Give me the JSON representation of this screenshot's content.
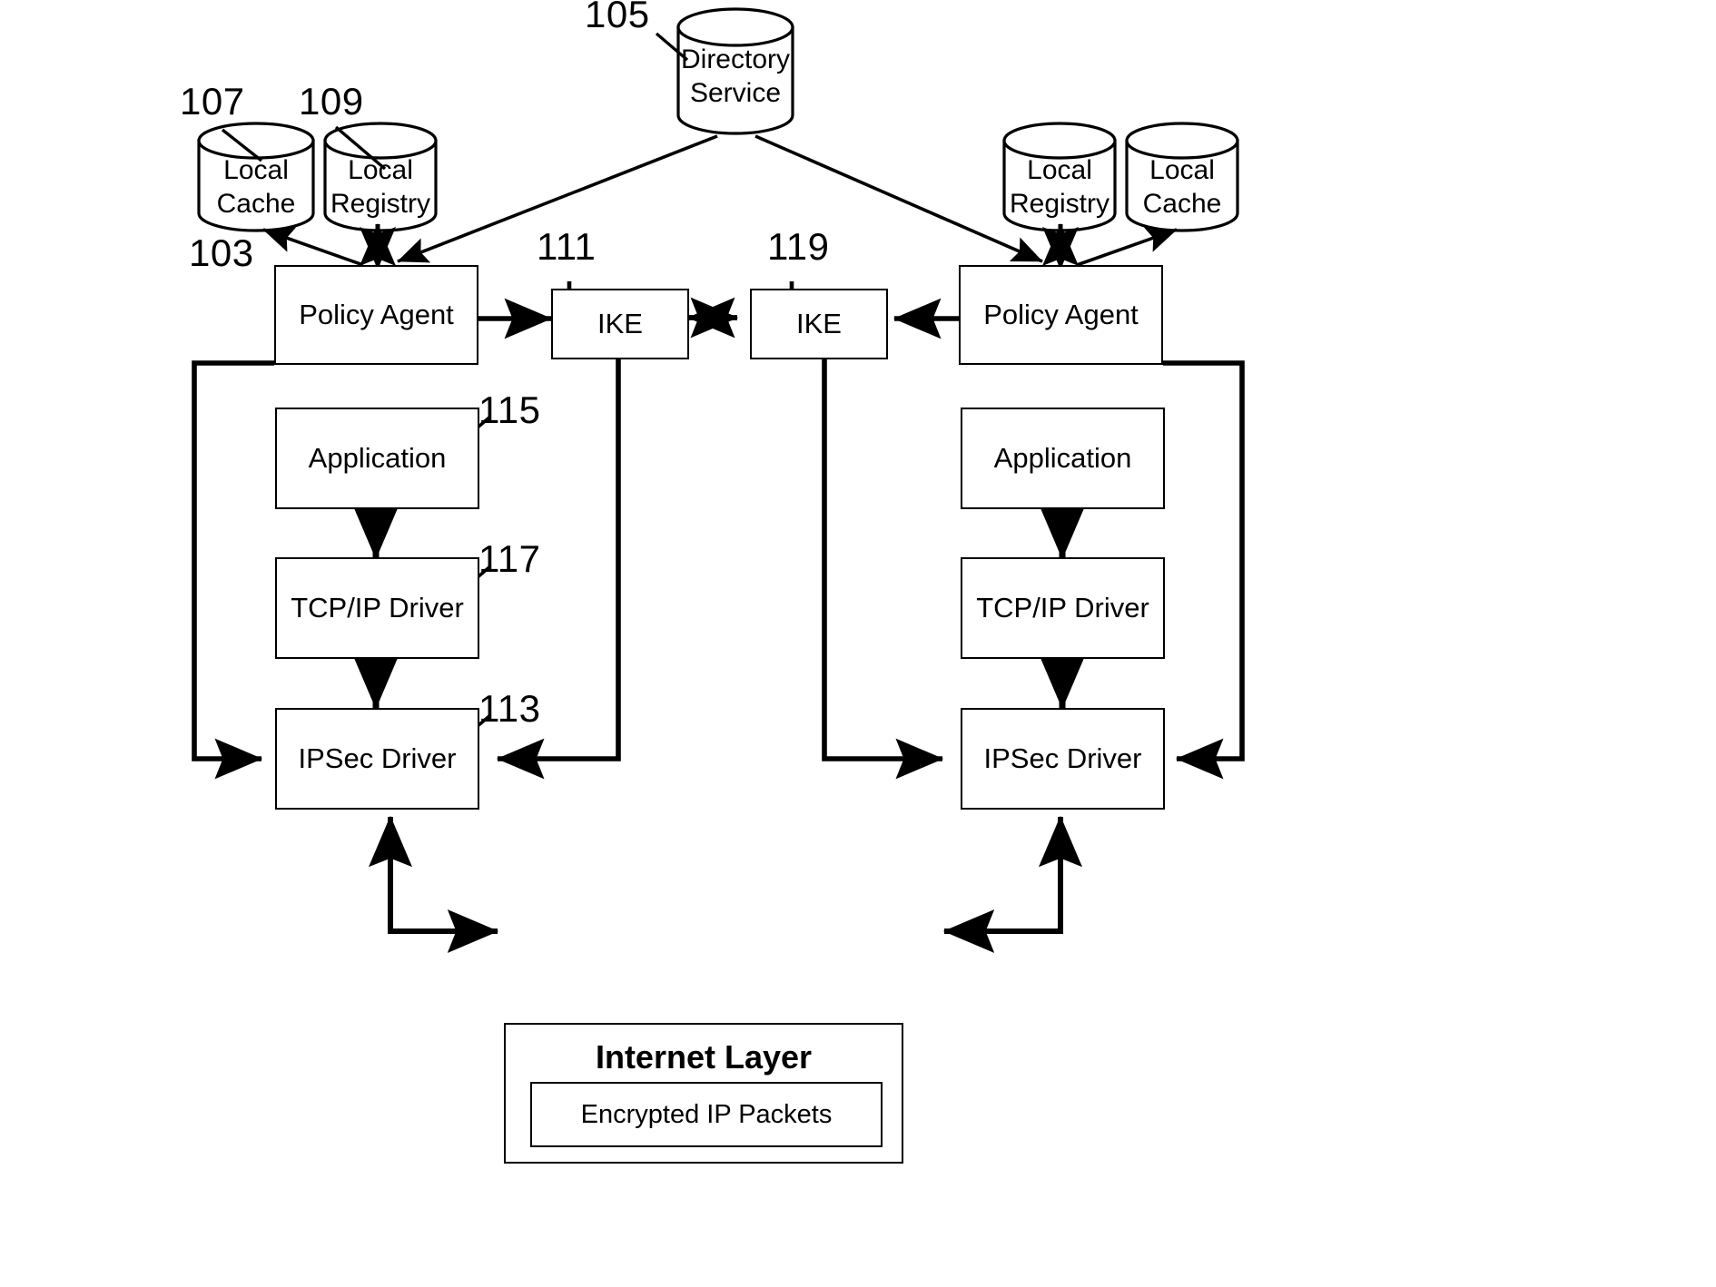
{
  "figure": {
    "title": "IPSec policy distribution architecture diagram",
    "line_color": "#000000",
    "background": "#ffffff"
  },
  "reference_numerals": {
    "directory_service": "105",
    "local_cache_left": "107",
    "local_registry_left": "109",
    "policy_agent_left": "103",
    "ike_left": "111",
    "ike_right": "119",
    "application_left": "115",
    "tcpip_driver_left": "117",
    "ipsec_driver_left": "113"
  },
  "nodes": {
    "directory_service": {
      "line1": "Directory",
      "line2": "Service"
    },
    "left": {
      "local_cache": {
        "line1": "Local",
        "line2": "Cache"
      },
      "local_registry": {
        "line1": "Local",
        "line2": "Registry"
      },
      "policy_agent": "Policy Agent",
      "ike": "IKE",
      "application": "Application",
      "tcpip_driver": "TCP/IP Driver",
      "ipsec_driver": "IPSec Driver"
    },
    "right": {
      "local_registry": {
        "line1": "Local",
        "line2": "Registry"
      },
      "local_cache": {
        "line1": "Local",
        "line2": "Cache"
      },
      "policy_agent": "Policy Agent",
      "ike": "IKE",
      "application": "Application",
      "tcpip_driver": "TCP/IP Driver",
      "ipsec_driver": "IPSec Driver"
    }
  },
  "internet_layer": {
    "title": "Internet Layer",
    "packets_label": "Encrypted IP Packets"
  }
}
